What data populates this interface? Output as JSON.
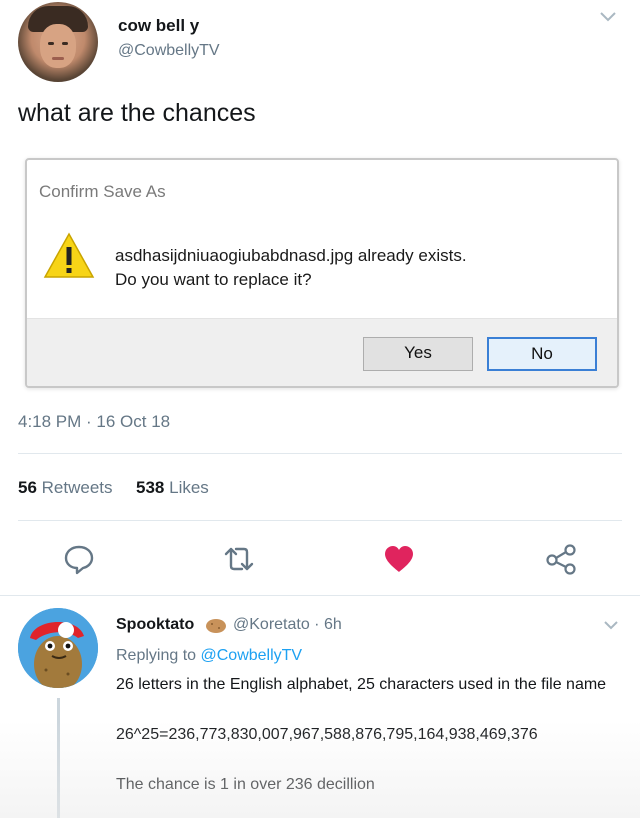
{
  "tweet": {
    "display_name": "cow bell y",
    "handle": "@CowbellyTV",
    "text": "what are the chances",
    "timestamp": "4:18 PM · 16 Oct 18",
    "retweets_count": "56",
    "retweets_label": "Retweets",
    "likes_count": "538",
    "likes_label": "Likes",
    "liked": true
  },
  "dialog": {
    "title": "Confirm Save As",
    "message_line1": "asdhasijdniuaogiubabdnasd.jpg already exists.",
    "message_line2": "Do you want to replace it?",
    "yes_label": "Yes",
    "no_label": "No",
    "icon": "warning-icon"
  },
  "actions": {
    "icons": [
      "reply-icon",
      "retweet-icon",
      "like-icon",
      "share-icon"
    ]
  },
  "reply": {
    "display_name": "Spooktato",
    "handle_time": "@Koretato · 6h",
    "replying_prefix": "Replying to",
    "replying_handle": "@CowbellyTV",
    "body_line1": "26 letters in the English alphabet, 25 characters used in the file name",
    "body_line2": "26^25=236,773,830,007,967,588,876,795,164,938,469,376",
    "body_line3": "The chance is 1 in over 236 decillion"
  },
  "colors": {
    "like_red": "#e0245e",
    "link_blue": "#1da1f2",
    "secondary_text": "#657786",
    "warning_yellow": "#f7d417"
  }
}
